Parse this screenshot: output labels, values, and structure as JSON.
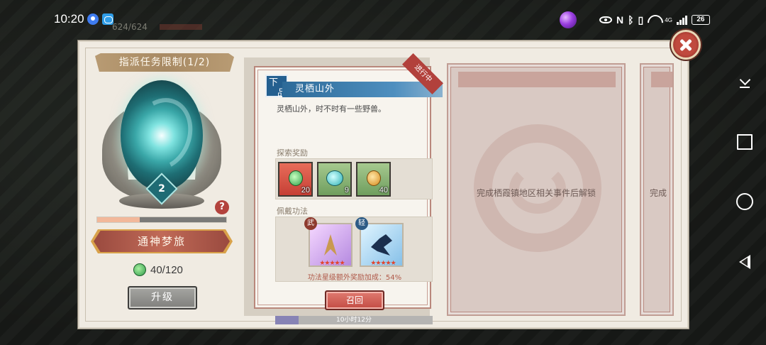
{
  "status_bar": {
    "time": "10:20",
    "nfc": "N",
    "signal_tag": "4G",
    "battery": "26"
  },
  "background": {
    "hud_text": "624/624"
  },
  "left_panel": {
    "limit_title": "指派任务限制(1/2)",
    "level": "2",
    "help": "?",
    "progress": 0.33,
    "name": "通神梦旅",
    "cost": "40/120",
    "upgrade_label": "升级"
  },
  "task": {
    "grade_top": "下",
    "grade_bottom": "品",
    "title": "灵栖山外",
    "status": "进行中",
    "description": "灵栖山外，时不时有一些野兽。",
    "reward_section": "探索奖励",
    "rewards": [
      {
        "qty": "20",
        "icon": "green-jade-icon"
      },
      {
        "qty": "9",
        "icon": "cyan-pearl-icon"
      },
      {
        "qty": "40",
        "icon": "gold-coin-icon"
      }
    ],
    "skill_section": "佩戴功法",
    "skills": [
      {
        "tag": "武",
        "stars": "★★★★★",
        "name": "martial-skill"
      },
      {
        "tag": "轻",
        "stars": "★★★★★",
        "name": "agility-skill"
      }
    ],
    "skill_bonus": "功法星级额外奖励加成：54%",
    "recall_label": "召回",
    "time_remaining": "10小时12分",
    "time_progress": 0.15
  },
  "locked_slots": [
    {
      "text": "完成栖霞镇地区相关事件后解锁"
    },
    {
      "text": "完成"
    }
  ],
  "colors": {
    "accent_red": "#c34c44",
    "title_blue": "#2d6a98",
    "panel_bg": "#f0ebe2"
  }
}
